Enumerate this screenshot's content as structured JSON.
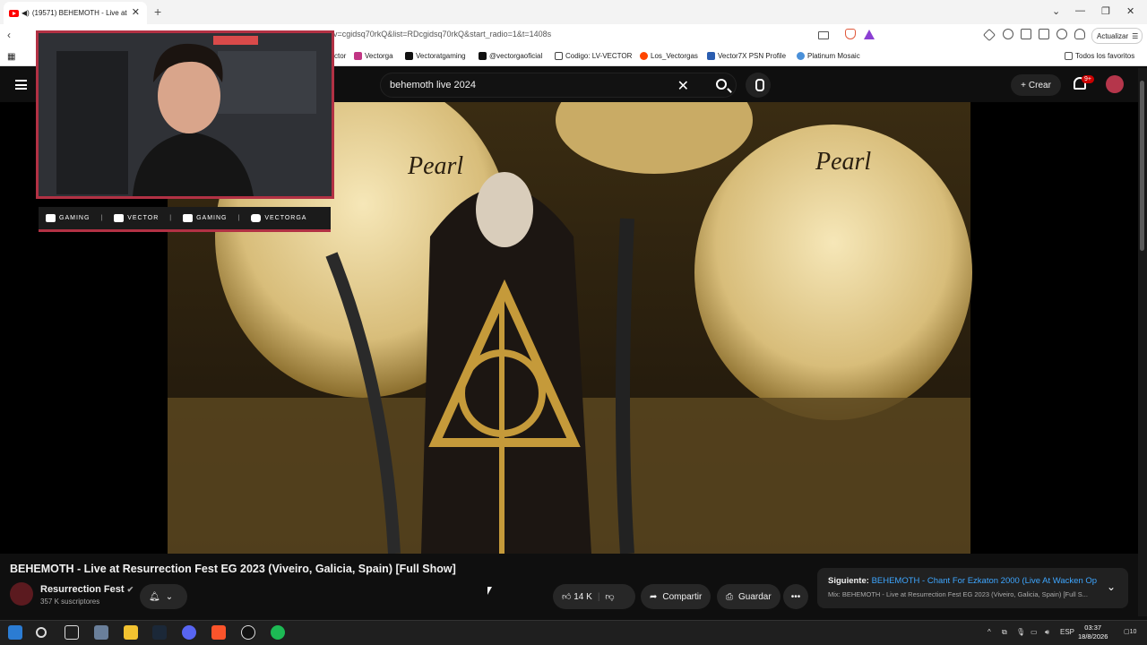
{
  "browser": {
    "tab_title": "(19571) BEHEMOTH - Live at",
    "url": "v=cgidsq70rkQ&list=RDcgidsq70rkQ&start_radio=1&t=1408s",
    "update_label": "Actualizar",
    "bookmarks": [
      "ctor",
      "Vectorga",
      "Vectoratgaming",
      "@vectorgaoficial",
      "Codigo: LV-VECTOR",
      "Los_Vectorgas",
      "Vector7X PSN Profile",
      "Platinum Mosaic"
    ],
    "all_bookmarks": "Todos los favoritos"
  },
  "youtube": {
    "search_query": "behemoth live 2024",
    "create_label": "Crear",
    "notif_count": "9+"
  },
  "overlay": {
    "social": [
      "GAMING",
      "VECTOR",
      "GAMING",
      "VECTORGA"
    ]
  },
  "video": {
    "title": "BEHEMOTH - Live at Resurrection Fest EG 2023 (Viveiro, Galicia, Spain) [Full Show]",
    "channel": "Resurrection Fest",
    "subscribers": "357 K suscriptores",
    "likes": "14 K",
    "share_label": "Compartir",
    "save_label": "Guardar",
    "next_prefix": "Siguiente:",
    "next_title": "BEHEMOTH - Chant For Ezkaton 2000 (Live At Wacken Ope...",
    "next_mix": "Mix: BEHEMOTH - Live at Resurrection Fest EG 2023 (Viveiro, Galicia, Spain) [Full S..."
  },
  "taskbar": {
    "lang": "ESP",
    "time": "03:37",
    "date": "18/8/2026",
    "notif": "10"
  }
}
